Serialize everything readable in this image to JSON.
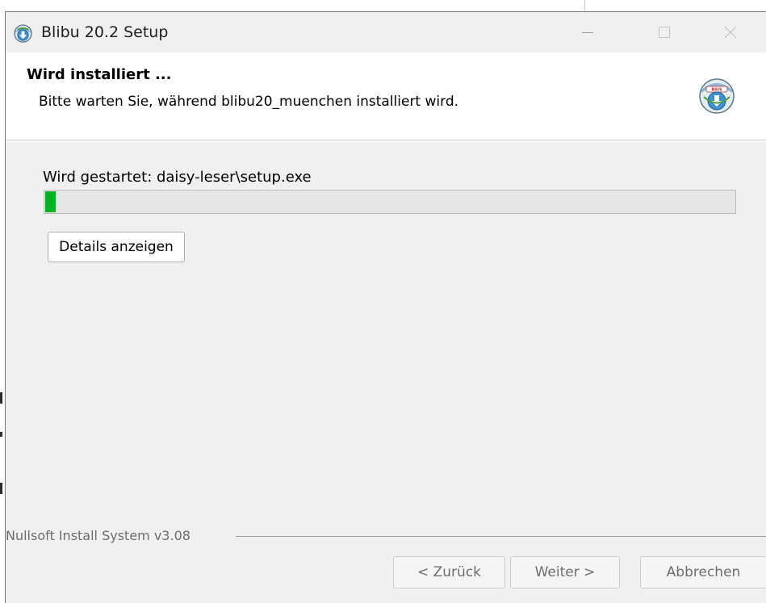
{
  "window": {
    "title": "Blibu 20.2 Setup",
    "icon": "nsis-setup-icon"
  },
  "titlebar_buttons": {
    "minimize": "minimize-icon",
    "maximize": "maximize-icon",
    "close": "close-icon"
  },
  "header": {
    "title": "Wird installiert ...",
    "subtitle": "Bitte warten Sie, während blibu20_muenchen installiert wird.",
    "logo": "nsis-logo-icon"
  },
  "install": {
    "status": "Wird gestartet: daisy-leser\\setup.exe",
    "progress_fraction": 0.015,
    "details_button": "Details anzeigen"
  },
  "footer": {
    "branding": "Nullsoft Install System v3.08",
    "back_button": "< Zurück",
    "next_button": "Weiter >",
    "cancel_button": "Abbrechen"
  },
  "colors": {
    "progress": "#06b025",
    "window_bg": "#f0f0f0",
    "header_bg": "#ffffff"
  }
}
